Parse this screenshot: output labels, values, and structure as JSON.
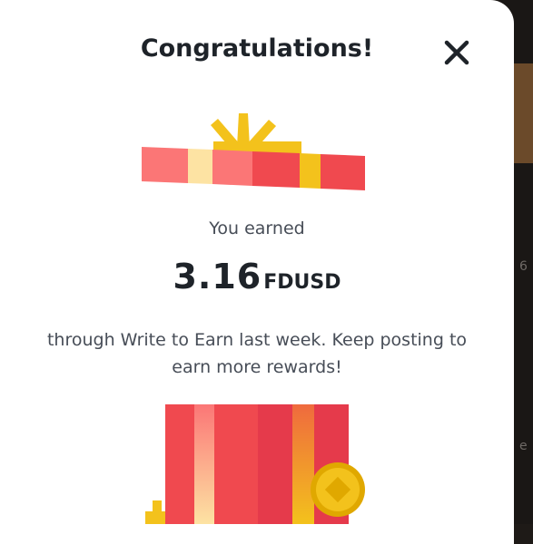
{
  "dialog": {
    "title": "Congratulations!",
    "close_icon": "close-icon",
    "earned_label": "You earned",
    "amount": "3.16",
    "currency": "FDUSD",
    "message": "through Write to Earn last week. Keep posting to earn more rewards!"
  },
  "colors": {
    "coral": "#fb7676",
    "red": "#f0494f",
    "crimson": "#e53a4b",
    "cream": "#fde3a3",
    "gold": "#f3c21c",
    "dark_gold": "#e0a800",
    "text_dark": "#1e2329",
    "text_muted": "#474d57"
  },
  "background": {
    "peek_chars": [
      "6",
      "e"
    ]
  }
}
